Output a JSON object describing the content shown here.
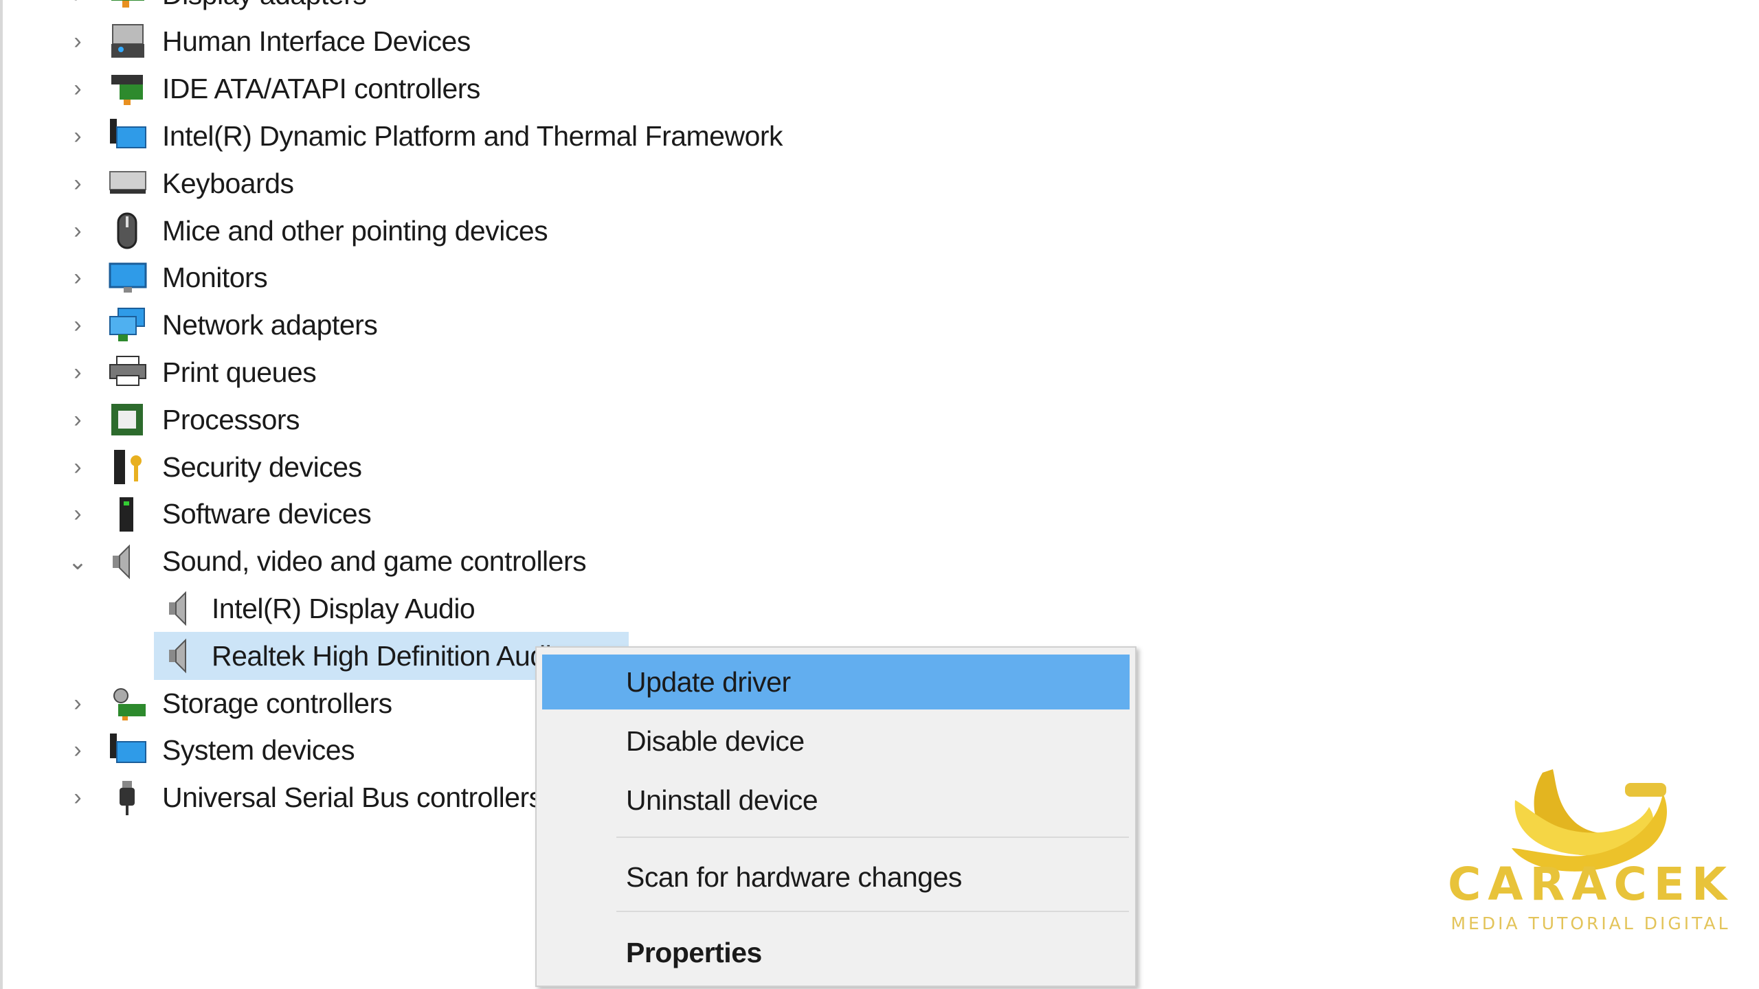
{
  "tree": {
    "items": [
      {
        "label": "Display adapters",
        "icon": "display-adapter-icon",
        "expanded": false
      },
      {
        "label": "Human Interface Devices",
        "icon": "hid-icon",
        "expanded": false
      },
      {
        "label": "IDE ATA/ATAPI controllers",
        "icon": "ide-controller-icon",
        "expanded": false
      },
      {
        "label": "Intel(R) Dynamic Platform and Thermal Framework",
        "icon": "system-folder-icon",
        "expanded": false
      },
      {
        "label": "Keyboards",
        "icon": "keyboard-icon",
        "expanded": false
      },
      {
        "label": "Mice and other pointing devices",
        "icon": "mouse-icon",
        "expanded": false
      },
      {
        "label": "Monitors",
        "icon": "monitor-icon",
        "expanded": false
      },
      {
        "label": "Network adapters",
        "icon": "network-adapter-icon",
        "expanded": false
      },
      {
        "label": "Print queues",
        "icon": "printer-icon",
        "expanded": false
      },
      {
        "label": "Processors",
        "icon": "processor-icon",
        "expanded": false
      },
      {
        "label": "Security devices",
        "icon": "security-device-icon",
        "expanded": false
      },
      {
        "label": "Software devices",
        "icon": "software-device-icon",
        "expanded": false
      },
      {
        "label": "Sound, video and game controllers",
        "icon": "speaker-icon",
        "expanded": true,
        "children": [
          {
            "label": "Intel(R) Display Audio",
            "icon": "speaker-icon"
          },
          {
            "label": "Realtek High Definition Audio",
            "icon": "speaker-icon",
            "selected": true
          }
        ]
      },
      {
        "label": "Storage controllers",
        "icon": "storage-controller-icon",
        "expanded": false
      },
      {
        "label": "System devices",
        "icon": "system-folder-icon",
        "expanded": false
      },
      {
        "label": "Universal Serial Bus controllers",
        "icon": "usb-icon",
        "expanded": false
      }
    ]
  },
  "context_menu": {
    "items": [
      "Update driver",
      "Disable device",
      "Uninstall device",
      "Scan for hardware changes",
      "Properties"
    ],
    "highlighted": "Update driver",
    "default_item": "Properties"
  },
  "watermark": {
    "brand": "CARACEK",
    "tagline": "MEDIA TUTORIAL DIGITAL"
  },
  "colors": {
    "selection": "#cce4f7",
    "menu_highlight": "#62aeef",
    "menu_bg": "#f0f0f0",
    "logo": "#e8c33a"
  }
}
